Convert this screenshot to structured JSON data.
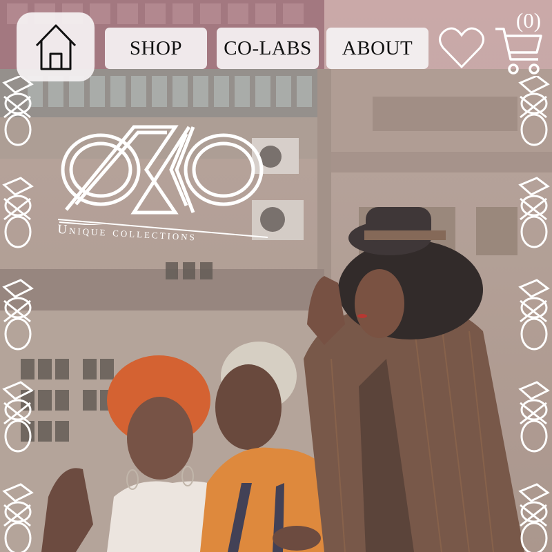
{
  "nav": {
    "home_icon": "home-icon",
    "items": [
      {
        "label": "SHOP"
      },
      {
        "label": "CO-LABS"
      },
      {
        "label": "ABOUT"
      }
    ],
    "wishlist_icon": "heart-icon",
    "cart_icon": "shopping-cart-icon",
    "cart_count": "(0)"
  },
  "brand": {
    "tagline": "Unique collections"
  },
  "colors": {
    "nav_button_bg": "#f5f2f3",
    "accent_orange": "#e0822c",
    "text_dark": "#111111",
    "logo_white": "#ffffff"
  }
}
